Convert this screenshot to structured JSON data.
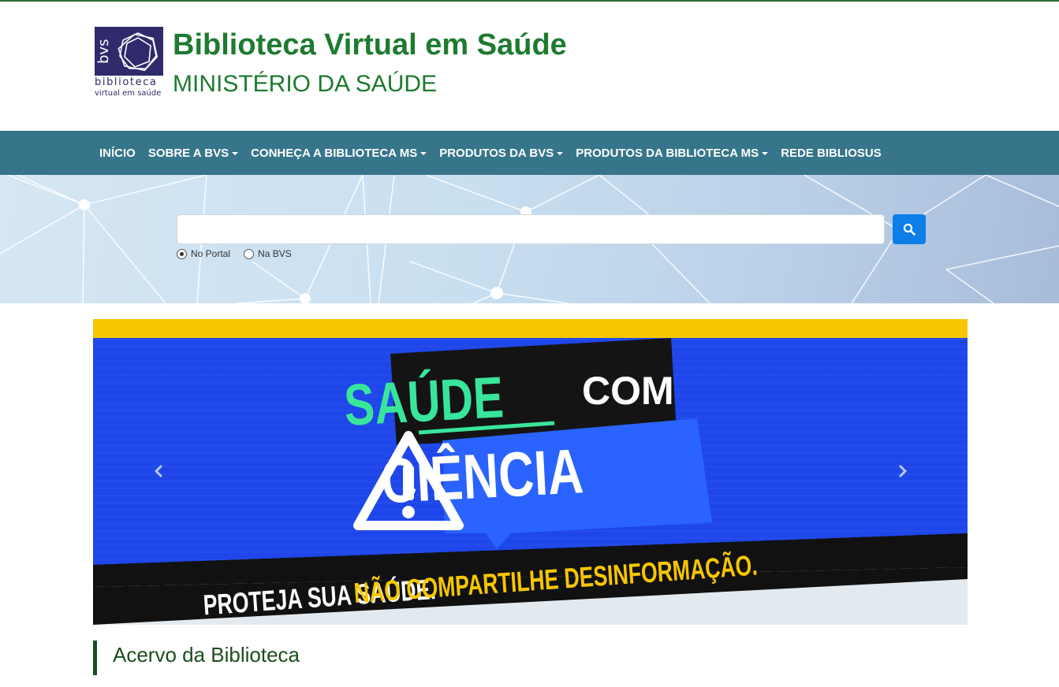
{
  "header": {
    "logo": {
      "abbr": "bvs",
      "line1": "biblioteca",
      "line2": "virtual em saúde"
    },
    "title": "Biblioteca Virtual em Saúde",
    "subtitle": "MINISTÉRIO DA SAÚDE"
  },
  "nav": {
    "items": [
      {
        "label": "INÍCIO",
        "dropdown": false
      },
      {
        "label": "SOBRE A BVS",
        "dropdown": true
      },
      {
        "label": "CONHEÇA A BIBLIOTECA MS",
        "dropdown": true
      },
      {
        "label": "PRODUTOS DA BVS",
        "dropdown": true
      },
      {
        "label": "PRODUTOS DA BIBLIOTECA MS",
        "dropdown": true
      },
      {
        "label": "REDE BIBLIOSUS",
        "dropdown": false
      }
    ]
  },
  "search": {
    "value": "",
    "button_icon": "search-icon",
    "scope_options": [
      {
        "label": "No Portal",
        "checked": true
      },
      {
        "label": "Na BVS",
        "checked": false
      }
    ]
  },
  "banner": {
    "word1": "SAÚDE",
    "word2": "COM",
    "word3": "CIÊNCIA",
    "footer_white": "PROTEJA SUA SAÚDE.",
    "footer_yellow": "NÃO COMPARTILHE DESINFORMAÇÃO.",
    "prev_icon": "chevron-left-icon",
    "next_icon": "chevron-right-icon"
  },
  "section": {
    "title": "Acervo da Biblioteca"
  },
  "colors": {
    "brand_green": "#1d7b2f",
    "nav_bg": "#37758a",
    "search_button": "#0d7de8",
    "logo_purple": "#2f2a6b",
    "banner_blue": "#1f43e8",
    "banner_yellow": "#f7c600",
    "banner_green": "#39e59b"
  }
}
